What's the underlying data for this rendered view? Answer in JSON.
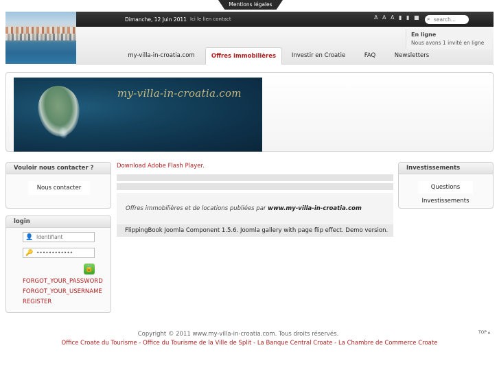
{
  "legal": {
    "label": "Mentions légales"
  },
  "topbar": {
    "date": "Dimanche, 12 Juin 2011",
    "contact": "Ici le lien contact",
    "tools": "A A A ▮ ▮ ■",
    "search_placeholder": "search..."
  },
  "online": {
    "title": "En ligne",
    "text": "Nous avons 1 invité en ligne"
  },
  "nav": [
    {
      "label": "my-villa-in-croatia.com"
    },
    {
      "label": "Offres immobilières"
    },
    {
      "label": "Investir en Croatie"
    },
    {
      "label": "FAQ"
    },
    {
      "label": "Newsletters"
    }
  ],
  "banner": {
    "brand": "my-villa-in-croatia.com"
  },
  "contact_box": {
    "title": "Vouloir nous contacter ?",
    "item": "Nous contacter"
  },
  "login_box": {
    "title": "login",
    "username_placeholder": "Identifiant",
    "password_value": "••••••••••••",
    "forgot_password": "FORGOT_YOUR_PASSWORD",
    "forgot_username": "FORGOT_YOUR_USERNAME",
    "register": "REGISTER"
  },
  "invest_box": {
    "title": "Investissements",
    "items": [
      "Questions",
      "Investissements"
    ]
  },
  "main": {
    "flash_link": "Download Adobe Flash Player.",
    "offers_prefix": "Offres immobilières et de locations publiées par ",
    "offers_site": "www.my-villa-in-croatia.com",
    "credit": "FlippingBook Joomla Component 1.5.6. Joomla gallery with page flip effect. Demo version."
  },
  "footer": {
    "copyright": "Copyright © 2011 www.my-villa-in-croatia.com. Tous droits réservés.",
    "links": [
      "Office Croate du Tourisme",
      "Office du Tourisme de la Ville de Split",
      "La Banque Central Croate",
      "La Chambre de Commerce Croate"
    ],
    "separator": " - ",
    "top": "TOP ▴"
  },
  "colors": {
    "accent": "#b01e1e",
    "dark_bar": "#2a2a2a"
  }
}
